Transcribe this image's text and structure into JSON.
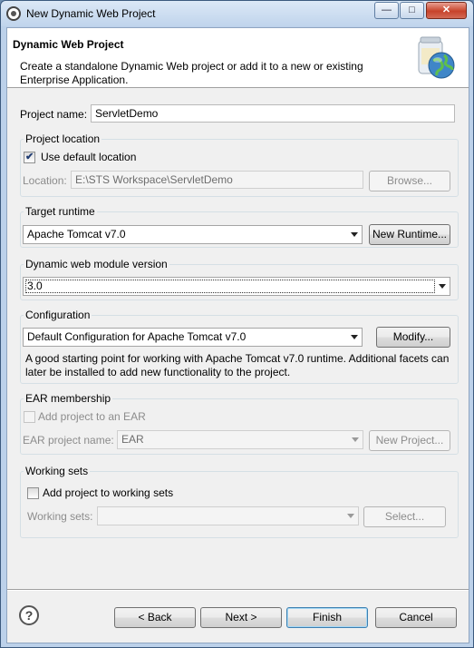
{
  "window": {
    "title": "New Dynamic Web Project",
    "minimize_glyph": "—",
    "maximize_glyph": "□",
    "close_glyph": "✕"
  },
  "header": {
    "title": "Dynamic Web Project",
    "description": "Create a standalone Dynamic Web project or add it to a new or existing Enterprise Application."
  },
  "project_name": {
    "label": "Project name:",
    "value": "ServletDemo"
  },
  "project_location": {
    "group_label": "Project location",
    "use_default_label": "Use default location",
    "use_default_checked": true,
    "location_label": "Location:",
    "location_value": "E:\\STS Workspace\\ServletDemo",
    "browse_label": "Browse..."
  },
  "target_runtime": {
    "group_label": "Target runtime",
    "selected": "Apache Tomcat v7.0",
    "new_runtime_label": "New Runtime..."
  },
  "module_version": {
    "group_label": "Dynamic web module version",
    "selected": "3.0"
  },
  "configuration": {
    "group_label": "Configuration",
    "selected": "Default Configuration for Apache Tomcat v7.0",
    "modify_label": "Modify...",
    "description": "A good starting point for working with Apache Tomcat v7.0 runtime. Additional facets can later be installed to add new functionality to the project."
  },
  "ear": {
    "group_label": "EAR membership",
    "add_label": "Add project to an EAR",
    "add_checked": false,
    "project_name_label": "EAR project name:",
    "project_name_value": "EAR",
    "new_project_label": "New Project..."
  },
  "working_sets": {
    "group_label": "Working sets",
    "add_label": "Add project to working sets",
    "add_checked": false,
    "sets_label": "Working sets:",
    "sets_value": "",
    "select_label": "Select..."
  },
  "footer": {
    "help_glyph": "?",
    "back_label": "< Back",
    "next_label": "Next >",
    "finish_label": "Finish",
    "cancel_label": "Cancel"
  },
  "icons": {
    "app": "app-icon",
    "header": "web-project-jar-globe-icon",
    "help": "help-icon"
  }
}
